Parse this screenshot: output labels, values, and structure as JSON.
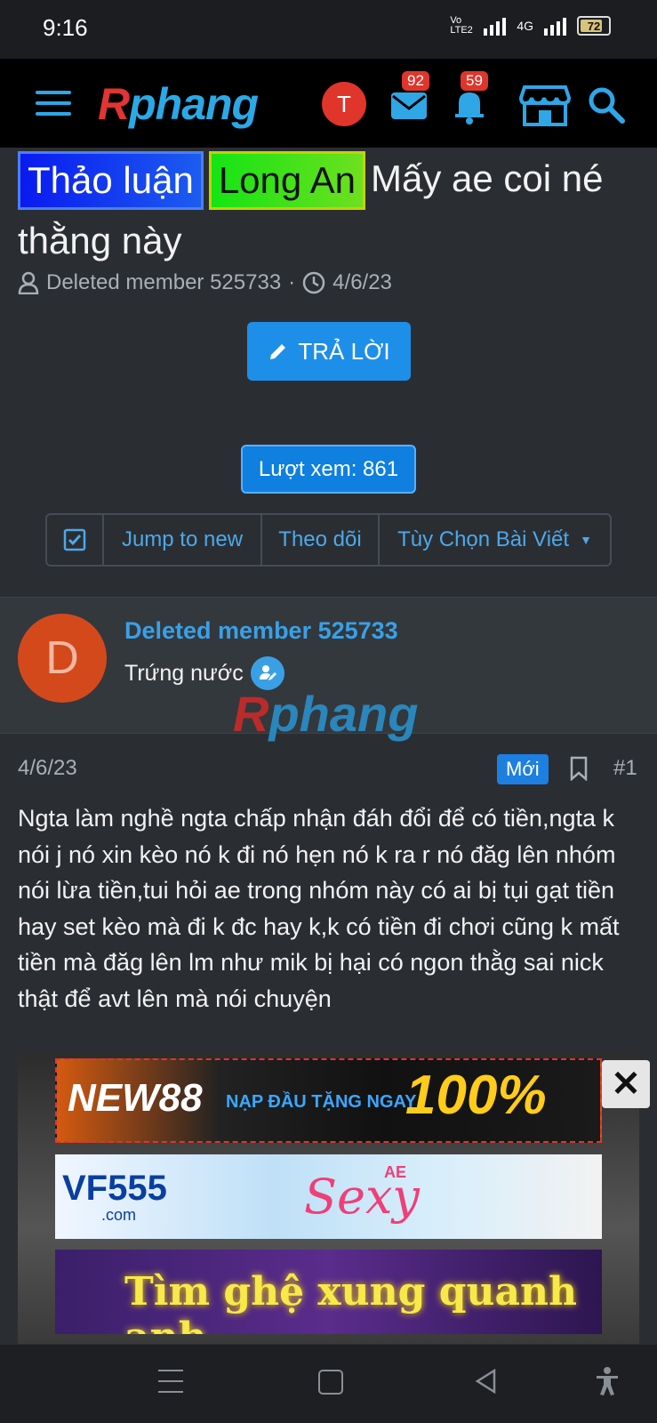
{
  "status_bar": {
    "time": "9:16",
    "network": "4G",
    "volte": "Vo LTE2",
    "battery": "72"
  },
  "header": {
    "logo_r": "R",
    "logo_rest": "phang",
    "avatar_letter": "T",
    "messages_badge": "92",
    "alerts_badge": "59",
    "colors": {
      "accent": "#2aa9e6",
      "logo_red": "#e23434"
    }
  },
  "thread": {
    "prefix1": "Thảo luận",
    "prefix2": "Long An",
    "title": "Mấy ae coi né thằng này",
    "author": "Deleted member 525733",
    "date": "4/6/23",
    "reply_label": "TRẢ LỜI",
    "views_label": "Lượt xem: 861",
    "toolbar": {
      "jump": "Jump to new",
      "follow": "Theo dõi",
      "options": "Tùy Chọn Bài Viết"
    }
  },
  "post": {
    "avatar_letter": "D",
    "username": "Deleted member 525733",
    "user_title": "Trứng nước",
    "watermark_r": "R",
    "watermark_rest": "phang",
    "date": "4/6/23",
    "new_label": "Mới",
    "number": "#1",
    "body": "Ngta làm nghề ngta chấp nhận đáh đổi để có tiền,ngta k nói j nó xin kèo nó k đi nó hẹn nó k ra r nó đăg lên nhóm nói lừa tiền,tui hỏi ae trong nhóm này có ai bị tụi gạt tiền hay set kèo mà đi k đc hay k,k có tiền đi chơi cũng k mất tiền mà đăg lên lm như mik bị hại có ngon thằg sai nick thật để avt lên mà nói chuyện"
  },
  "ads": {
    "ad1": {
      "brand": "NEW88",
      "text": "NẠP ĐẦU TẶNG NGAY",
      "big": "100%"
    },
    "ad2": {
      "brand": "VF555",
      "sub": ".com",
      "partner": "Sexy",
      "partner_tag": "AE"
    },
    "ad3": {
      "text": "Tìm ghệ xung quanh anh"
    }
  }
}
